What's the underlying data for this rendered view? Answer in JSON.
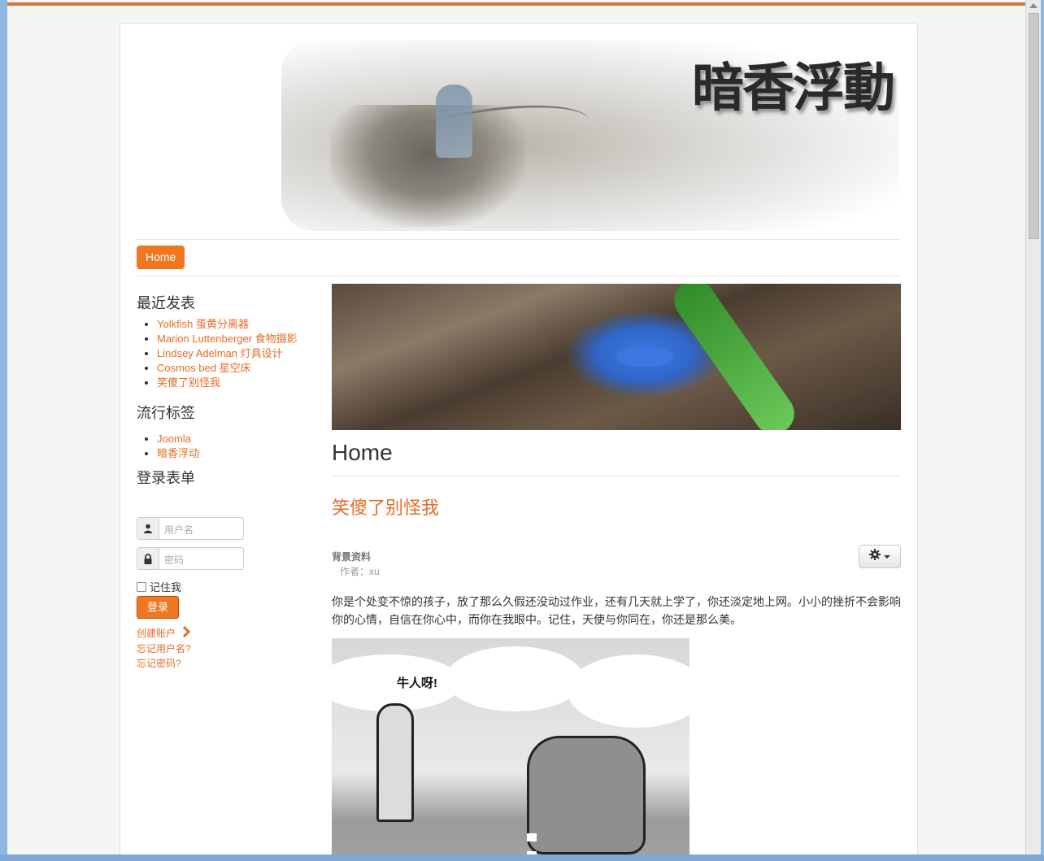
{
  "site": {
    "banner_title": "暗香浮動"
  },
  "nav": {
    "home_label": "Home"
  },
  "sidebar": {
    "recent_heading": "最近发表",
    "recent_items": [
      "Yolkfish 蛋黄分离器",
      "Marion Luttenberger 食物摄影",
      "Lindsey Adelman 灯具设计",
      "Cosmos bed 星空床",
      "笑傻了别怪我"
    ],
    "tags_heading": "流行标签",
    "tags": [
      "Joomla",
      "暗香浮动"
    ],
    "login_heading": "登录表单",
    "username_placeholder": "用户名",
    "password_placeholder": "密码",
    "remember_label": "记住我",
    "login_button": "登录",
    "create_account": "创建账户",
    "forgot_username": "忘记用户名?",
    "forgot_password": "忘记密码?"
  },
  "main": {
    "page_heading": "Home",
    "article_title": "笑傻了别怪我",
    "category_label": "背景资料",
    "author_line": "作者：xu",
    "body": "你是个处变不惊的孩子，放了那么久假还没动过作业，还有几天就上学了，你还淡定地上网。小小的挫折不会影响你的心情，自信在你心中，而你在我眼中。记住，天使与你同在，你还是那么美。",
    "cartoon_caption": "牛人呀!"
  },
  "colors": {
    "accent": "#f07722",
    "link": "#e56c25"
  },
  "icons": [
    "user-icon",
    "lock-icon",
    "gear-icon",
    "chevron-right-icon"
  ]
}
